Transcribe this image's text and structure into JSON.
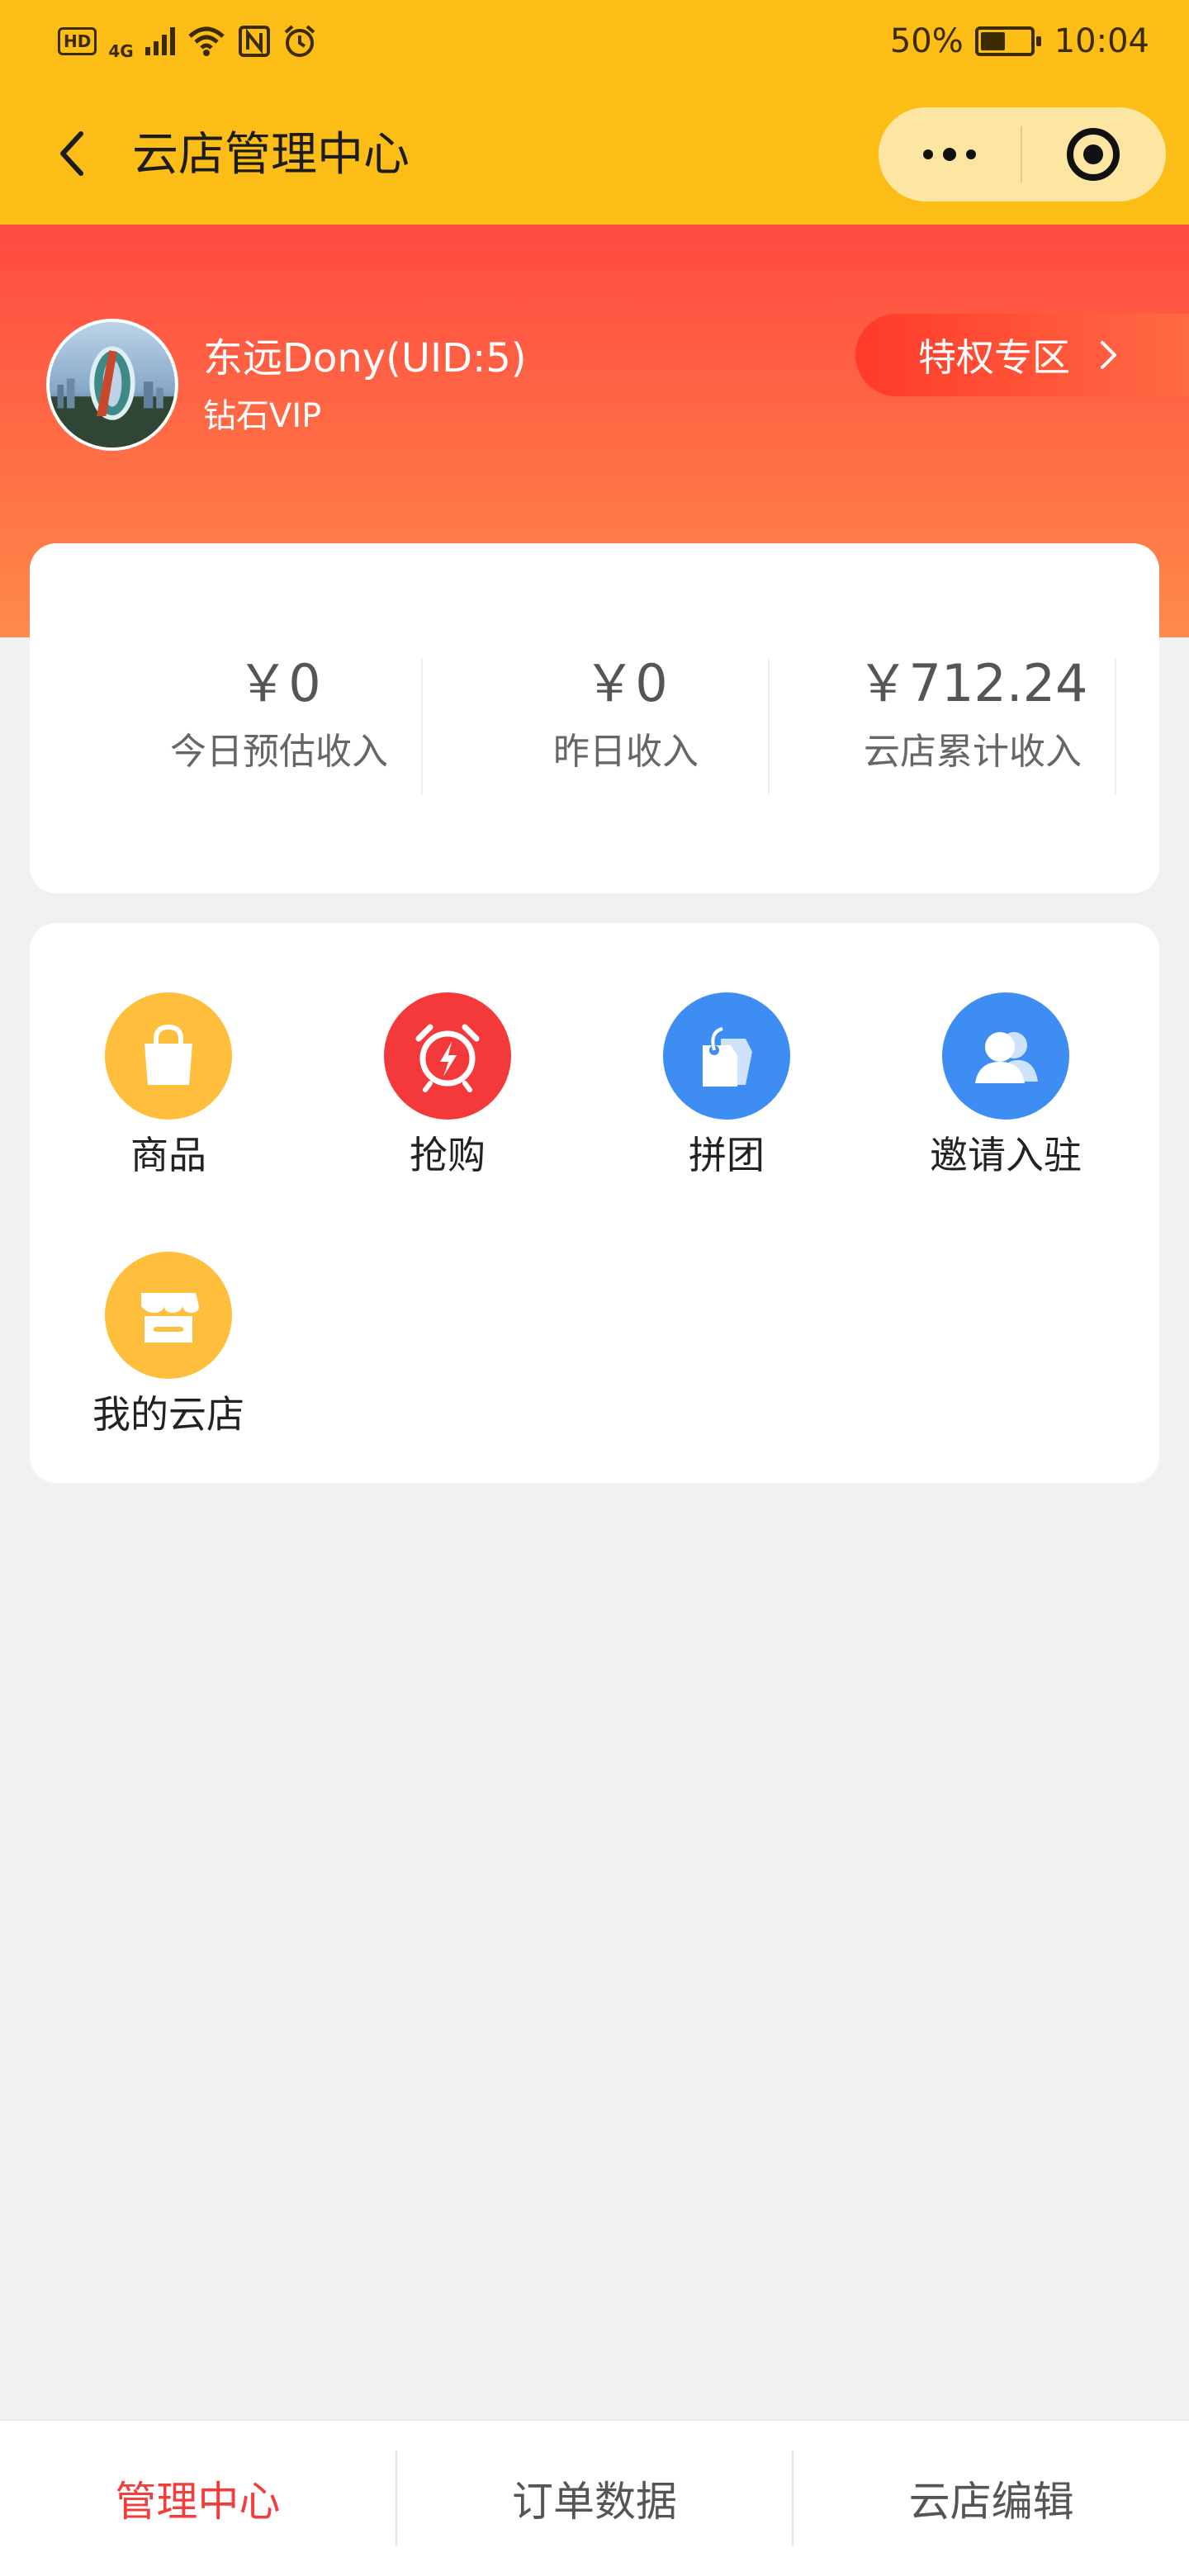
{
  "status_bar": {
    "hd": "HD",
    "network": "4G",
    "battery_text": "50%",
    "battery_level": 0.5,
    "time": "10:04"
  },
  "header": {
    "title": "云店管理中心"
  },
  "profile": {
    "name": "东远Dony(UID:5)",
    "level": "钻石VIP",
    "privilege_label": "特权专区"
  },
  "income": [
    {
      "value": "￥0",
      "label": "今日预估收入"
    },
    {
      "value": "￥0",
      "label": "昨日收入"
    },
    {
      "value": "￥712.24",
      "label": "云店累计收入"
    }
  ],
  "menu": [
    {
      "label": "商品",
      "icon": "shopping-bag-icon",
      "color": "#ffbe3c"
    },
    {
      "label": "抢购",
      "icon": "alarm-clock-icon",
      "color": "#f3393a"
    },
    {
      "label": "拼团",
      "icon": "price-tag-icon",
      "color": "#3e8df3"
    },
    {
      "label": "邀请入驻",
      "icon": "users-icon",
      "color": "#3e8df3"
    },
    {
      "label": "我的云店",
      "icon": "storefront-icon",
      "color": "#ffbe3c"
    }
  ],
  "tabs": [
    {
      "label": "管理中心",
      "active": true
    },
    {
      "label": "订单数据",
      "active": false
    },
    {
      "label": "云店编辑",
      "active": false
    }
  ],
  "colors": {
    "header_bg": "#fcbd17",
    "hero_top": "#ff4a42",
    "hero_bottom": "#ff8a4a",
    "active_tab": "#f23d3d",
    "page_bg": "#f1f1f1"
  }
}
